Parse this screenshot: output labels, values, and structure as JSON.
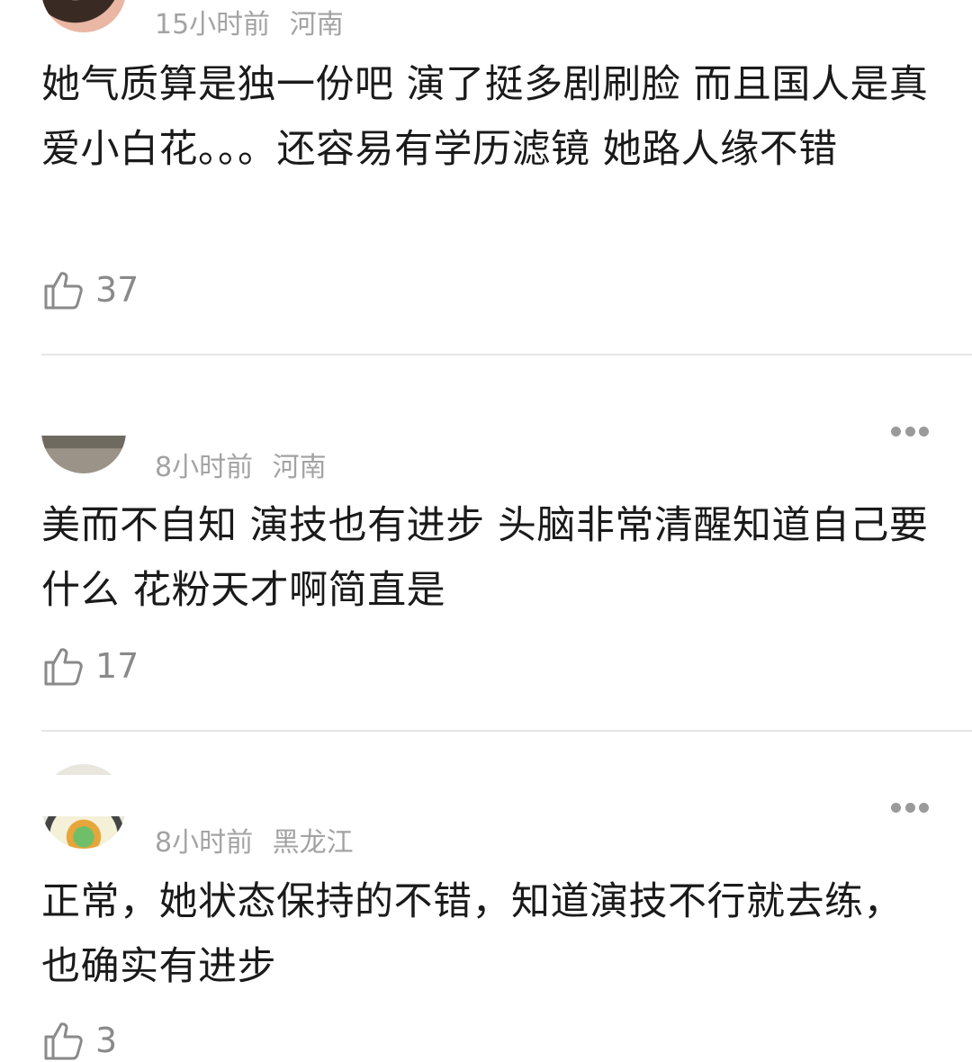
{
  "comments": [
    {
      "time": "15小时前",
      "location": "河南",
      "text": "她气质算是独一份吧 演了挺多剧刷脸 而且国人是真爱小白花。。。还容易有学历滤镜 她路人缘不错",
      "likes": "37"
    },
    {
      "time": "8小时前",
      "location": "河南",
      "text": "美而不自知 演技也有进步 头脑非常清醒知道自己要什么 花粉天才啊简直是",
      "likes": "17"
    },
    {
      "time": "8小时前",
      "location": "黑龙江",
      "text": "正常，她状态保持的不错，知道演技不行就去练，也确实有进步",
      "likes": "3"
    }
  ],
  "icons": {
    "like": "thumbs-up-icon",
    "more": "more-dots-icon"
  },
  "colors": {
    "text": "#1a1a1a",
    "meta": "#a3a3a3",
    "divider": "#e6e6e6",
    "icon": "#8a8a8a"
  }
}
